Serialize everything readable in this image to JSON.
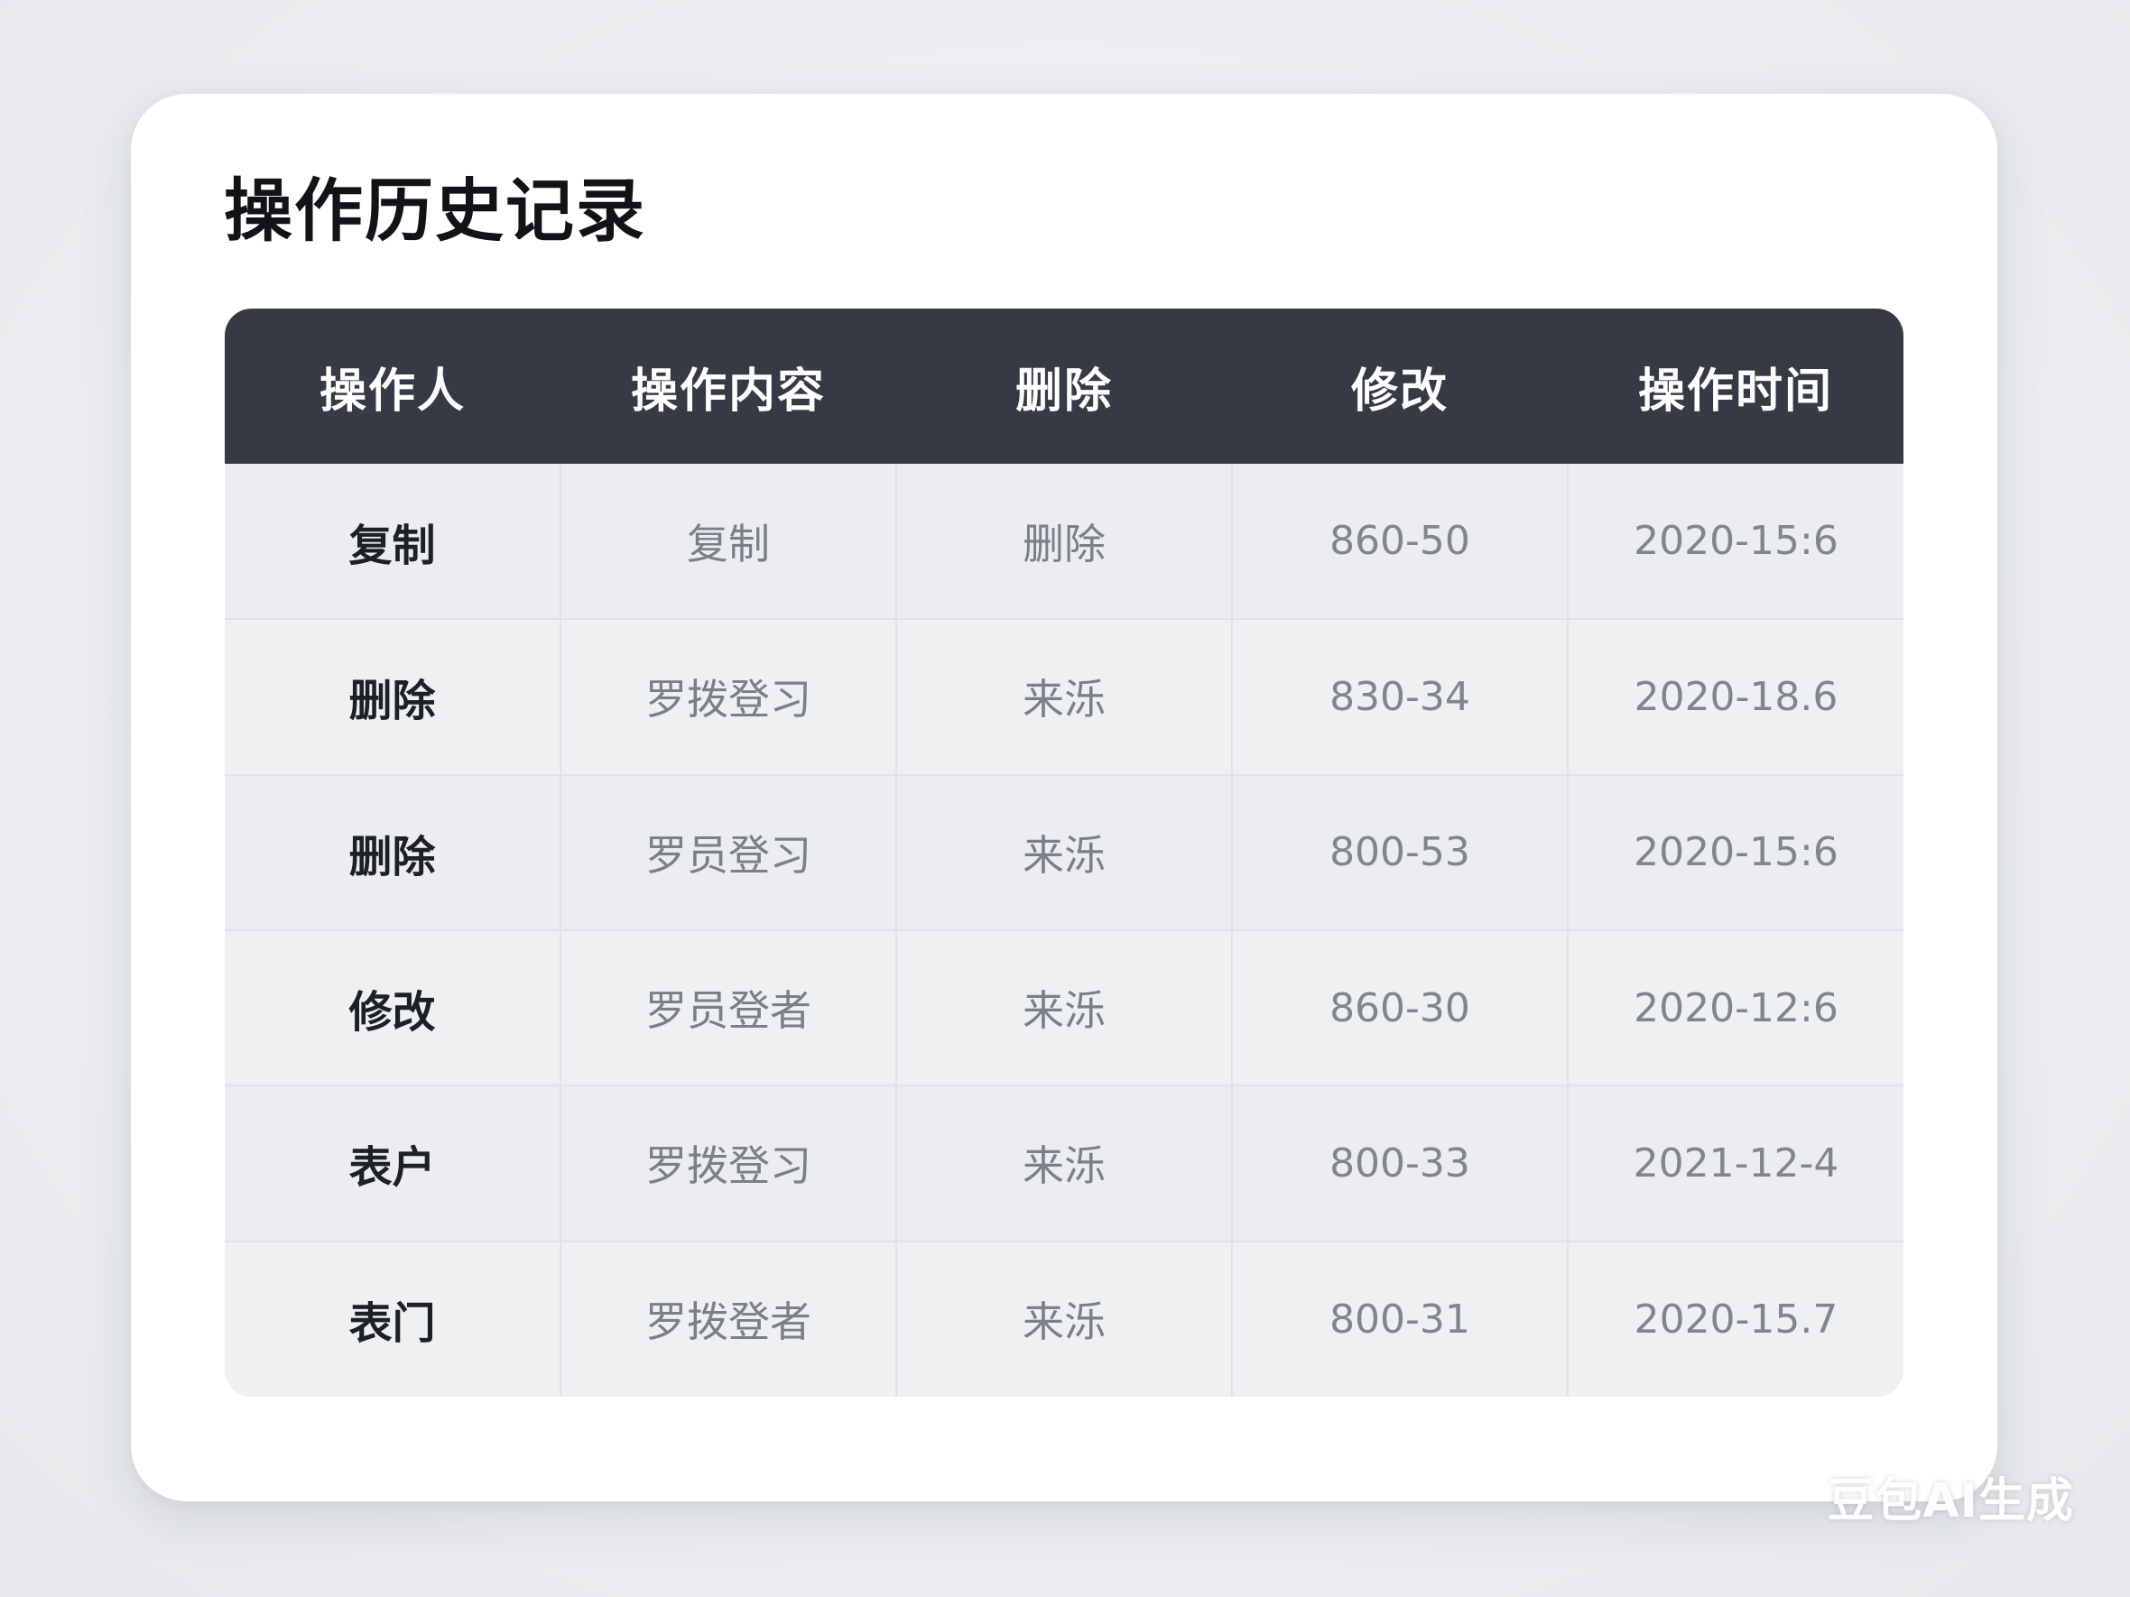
{
  "page": {
    "title": "操作历史记录"
  },
  "table": {
    "columns": [
      "操作人",
      "操作内容",
      "删除",
      "修改",
      "操作时间"
    ],
    "rows": [
      {
        "operator": "复制",
        "content": "复制",
        "delete": "删除",
        "modify": "860-50",
        "time": "2020-15:6"
      },
      {
        "operator": "删除",
        "content": "罗拨登习",
        "delete": "来泺",
        "modify": "830-34",
        "time": "2020-18.6"
      },
      {
        "operator": "删除",
        "content": "罗员登习",
        "delete": "来泺",
        "modify": "800-53",
        "time": "2020-15:6"
      },
      {
        "operator": "修改",
        "content": "罗员登者",
        "delete": "来泺",
        "modify": "860-30",
        "time": "2020-12:6"
      },
      {
        "operator": "表户",
        "content": "罗拨登习",
        "delete": "来泺",
        "modify": "800-33",
        "time": "2021-12-4"
      },
      {
        "operator": "表门",
        "content": "罗拨登者",
        "delete": "来泺",
        "modify": "800-31",
        "time": "2020-15.7"
      }
    ]
  },
  "watermark": {
    "text": "豆包AI生成"
  },
  "colors": {
    "header_bg": "#353a44",
    "header_text": "#ffffff",
    "card_bg": "#ffffff",
    "row_bg": "#eef0f2",
    "operator_text": "#1d2026",
    "cell_text": "#7a7f88"
  }
}
